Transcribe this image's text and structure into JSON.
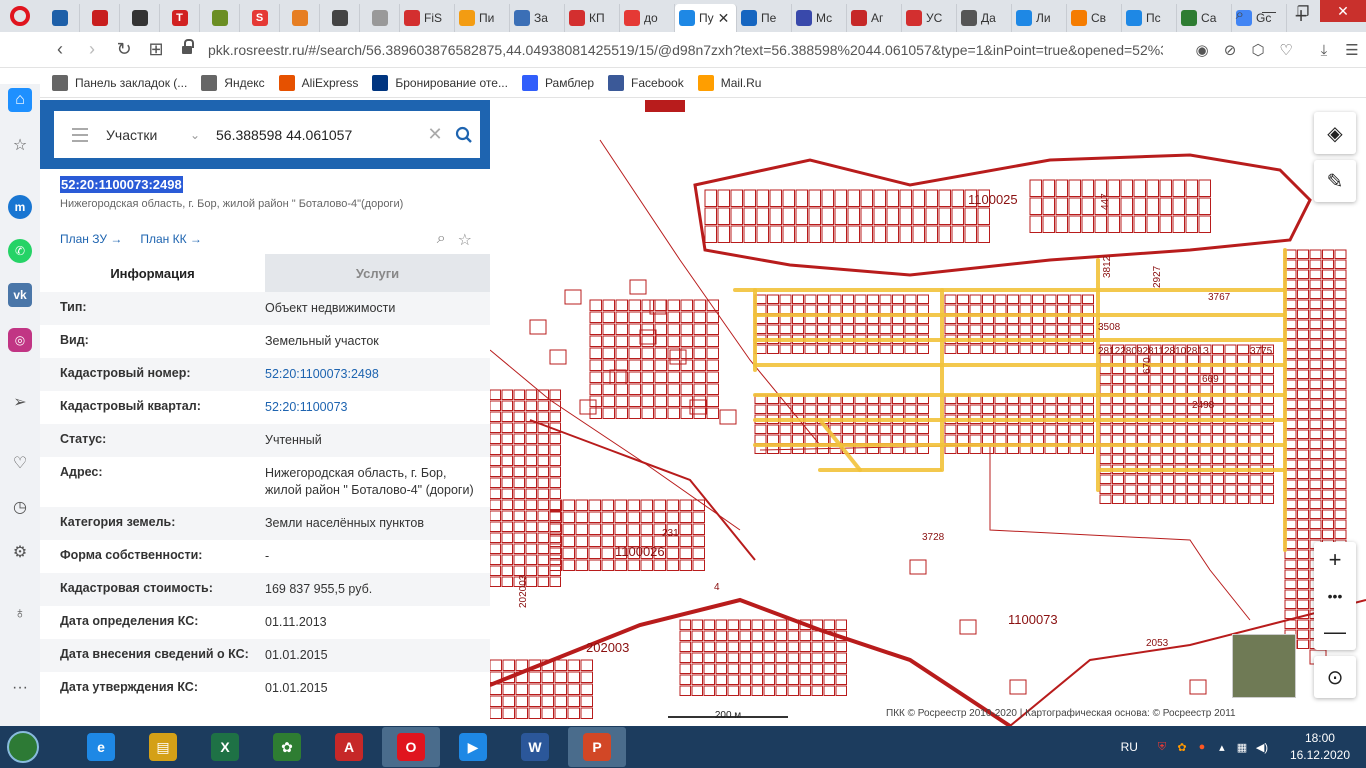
{
  "browser": {
    "tabs": [
      {
        "label": "",
        "color": "#1d5fa8"
      },
      {
        "label": "",
        "color": "#c81e1e"
      },
      {
        "label": "",
        "color": "#333333"
      },
      {
        "label": "T",
        "color": "#d12121"
      },
      {
        "label": "",
        "color": "#6b8e23"
      },
      {
        "label": "S",
        "color": "#e53935"
      },
      {
        "label": "",
        "color": "#e67e22"
      },
      {
        "label": "",
        "color": "#444444"
      },
      {
        "label": "",
        "color": "#999999"
      },
      {
        "label": "FiS",
        "color": "#d32f2f"
      },
      {
        "label": "Пи",
        "color": "#f39c12"
      },
      {
        "label": "За",
        "color": "#3b6fb6"
      },
      {
        "label": "КП",
        "color": "#d32f2f"
      },
      {
        "label": "до",
        "color": "#e53935"
      },
      {
        "label": "Пу",
        "color": "#1e88e5",
        "active": true
      },
      {
        "label": "Пе",
        "color": "#1565c0"
      },
      {
        "label": "Мс",
        "color": "#3949ab"
      },
      {
        "label": "Аг",
        "color": "#c62828"
      },
      {
        "label": "УС",
        "color": "#d32f2f"
      },
      {
        "label": "Да",
        "color": "#555555"
      },
      {
        "label": "Ли",
        "color": "#1e88e5"
      },
      {
        "label": "Св",
        "color": "#f57c00"
      },
      {
        "label": "Пс",
        "color": "#1e88e5"
      },
      {
        "label": "Са",
        "color": "#2e7d32"
      },
      {
        "label": "Gc",
        "color": "#4285f4"
      }
    ],
    "url": "pkk.rosreestr.ru/#/search/56.389603876582875,44.04938081425519/15/@d98n7zxh?text=56.388598%2044.061057&type=1&inPoint=true&opened=52%3",
    "bookmarks": [
      {
        "label": "Панель закладок (...",
        "icon": "folder-icon",
        "color": "#666666"
      },
      {
        "label": "Яндекс",
        "icon": "file-icon",
        "color": "#666666"
      },
      {
        "label": "AliExpress",
        "icon": "aliexpress-icon",
        "color": "#e65100"
      },
      {
        "label": "Бронирование оте...",
        "icon": "booking-icon",
        "color": "#003580"
      },
      {
        "label": "Рамблер",
        "icon": "rambler-icon",
        "color": "#315efb"
      },
      {
        "label": "Facebook",
        "icon": "facebook-icon",
        "color": "#3b5998"
      },
      {
        "label": "Mail.Ru",
        "icon": "mailru-icon",
        "color": "#ff9e00"
      }
    ]
  },
  "search": {
    "type": "Участки",
    "value": "56.388598 44.061057"
  },
  "object": {
    "cadastral_number": "52:20:1100073:2498",
    "address_short": "Нижегородская область, г. Бор, жилой район \" Боталово-4\"(дороги)",
    "plan_zu": "План ЗУ →",
    "plan_kk": "План КК →"
  },
  "tabs": {
    "info": "Информация",
    "services": "Услуги"
  },
  "rows": [
    {
      "label": "Тип:",
      "value": "Объект недвижимости",
      "link": false
    },
    {
      "label": "Вид:",
      "value": "Земельный участок",
      "link": false
    },
    {
      "label": "Кадастровый номер:",
      "value": "52:20:1100073:2498",
      "link": true
    },
    {
      "label": "Кадастровый квартал:",
      "value": "52:20:1100073",
      "link": true
    },
    {
      "label": "Статус:",
      "value": "Учтенный",
      "link": false
    },
    {
      "label": "Адрес:",
      "value": "Нижегородская область, г. Бор, жилой район \" Боталово-4\" (дороги)",
      "link": false
    },
    {
      "label": "Категория земель:",
      "value": "Земли населённых пунктов",
      "link": false
    },
    {
      "label": "Форма собственности:",
      "value": "-",
      "link": false
    },
    {
      "label": "Кадастровая стоимость:",
      "value": "169 837 955,5 руб.",
      "link": false
    },
    {
      "label": "Дата определения КС:",
      "value": "01.11.2013",
      "link": false
    },
    {
      "label": "Дата внесения сведений о КС:",
      "value": "01.01.2015",
      "link": false
    },
    {
      "label": "Дата утверждения КС:",
      "value": "01.01.2015",
      "link": false
    }
  ],
  "map": {
    "labels": [
      {
        "text": "1100025",
        "cls": "big"
      },
      {
        "text": "447"
      },
      {
        "text": "3812"
      },
      {
        "text": "2927"
      },
      {
        "text": "3767"
      },
      {
        "text": "3508"
      },
      {
        "text": "2812280928112810281З"
      },
      {
        "text": "3775"
      },
      {
        "text": "670"
      },
      {
        "text": "669"
      },
      {
        "text": "2498"
      },
      {
        "text": "3728"
      },
      {
        "text": "1100026",
        "cls": "big"
      },
      {
        "text": "231"
      },
      {
        "text": "4"
      },
      {
        "text": "202003"
      },
      {
        "text": "202003",
        "cls": "big"
      },
      {
        "text": "1100073",
        "cls": "big"
      },
      {
        "text": "2053"
      }
    ],
    "scale": "200 м",
    "copyright": "ПКК © Росреестр 2010-2020 | Картографическая основа: © Росреестр 2011"
  },
  "taskbar": {
    "lang": "RU",
    "time": "18:00",
    "date": "16.12.2020",
    "apps": [
      {
        "name": "internet-explorer",
        "label": "e",
        "color": "#1e88e5"
      },
      {
        "name": "explorer",
        "label": "▤",
        "color": "#d4a017"
      },
      {
        "name": "excel",
        "label": "X",
        "color": "#1e7145"
      },
      {
        "name": "icq",
        "label": "✿",
        "color": "#2e7d32"
      },
      {
        "name": "acrobat",
        "label": "A",
        "color": "#c62828"
      },
      {
        "name": "opera",
        "label": "O",
        "color": "#e0141e",
        "open": true
      },
      {
        "name": "media",
        "label": "▶",
        "color": "#1e88e5"
      },
      {
        "name": "word",
        "label": "W",
        "color": "#2b579a"
      },
      {
        "name": "powerpoint",
        "label": "P",
        "color": "#d24726",
        "open": true
      }
    ]
  },
  "colors": {
    "accent": "#1e64b0",
    "parcel": "#b81c1c",
    "road": "#f2c23a"
  }
}
